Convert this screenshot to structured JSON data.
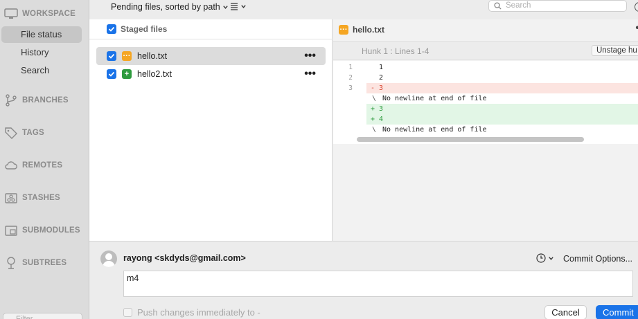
{
  "sidebar": {
    "workspace": "WORKSPACE",
    "items": [
      {
        "label": "File status"
      },
      {
        "label": "History"
      },
      {
        "label": "Search"
      }
    ],
    "sections": {
      "branches": "BRANCHES",
      "tags": "TAGS",
      "remotes": "REMOTES",
      "stashes": "STASHES",
      "submodules": "SUBMODULES",
      "subtrees": "SUBTREES"
    },
    "filter_placeholder": "Filter"
  },
  "toolbar": {
    "sort_label": "Pending files, sorted by path",
    "search_placeholder": "Search"
  },
  "files": {
    "staged_header": "Staged files",
    "rows": [
      {
        "name": "hello.txt",
        "status": "modified",
        "icon": "modified-icon"
      },
      {
        "name": "hello2.txt",
        "status": "added",
        "icon": "added-icon"
      }
    ]
  },
  "diff": {
    "file": "hello.txt",
    "hunk_title": "Hunk 1 : Lines 1-4",
    "unstage_label": "Unstage hu",
    "lines": [
      {
        "num": "1",
        "mark": "",
        "text": "1",
        "type": "ctx"
      },
      {
        "num": "2",
        "mark": "",
        "text": "2",
        "type": "ctx"
      },
      {
        "num": "3",
        "mark": "-",
        "text": "3",
        "type": "del"
      },
      {
        "num": "",
        "mark": "\\",
        "text": "No newline at end of file",
        "type": "nonl"
      },
      {
        "num": "",
        "mark": "+",
        "text": "3",
        "type": "add"
      },
      {
        "num": "",
        "mark": "+",
        "text": "4",
        "type": "add"
      },
      {
        "num": "",
        "mark": "\\",
        "text": "No newline at end of file",
        "type": "nonl"
      }
    ]
  },
  "commit": {
    "author": "rayong <skdyds@gmail.com>",
    "options_label": "Commit Options...",
    "message": "m4",
    "push_label": "Push changes immediately to -",
    "cancel_label": "Cancel",
    "commit_label": "Commit"
  },
  "colors": {
    "accent": "#1a73e8",
    "modified": "#f5a623",
    "added": "#2e9b3e",
    "deleted": "#d9442f"
  }
}
